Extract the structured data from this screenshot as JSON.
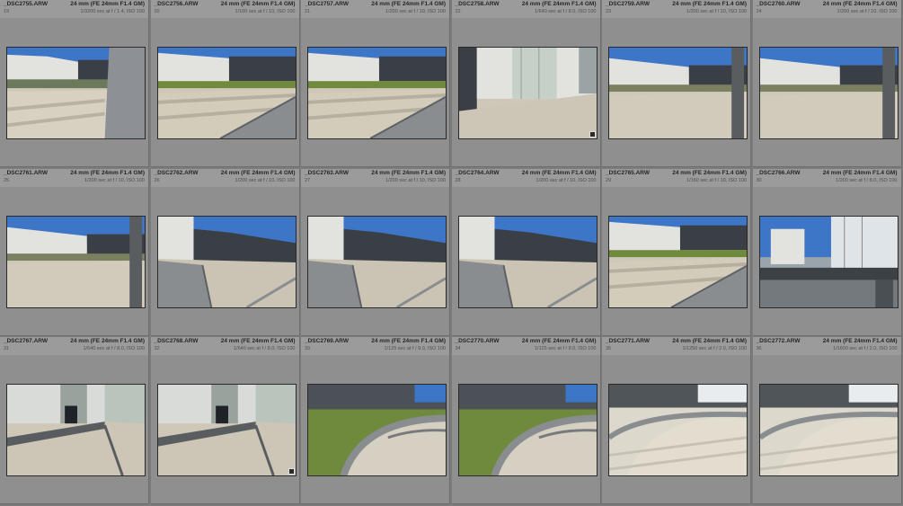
{
  "photos": [
    {
      "index": "19",
      "filename": "_DSC2755.ARW",
      "lens": "24 mm (FE 24mm F1.4 GM)",
      "exposure": "1/3200 sec at f / 1.4, ISO 100",
      "scene": "plaza-left",
      "badge": false
    },
    {
      "index": "20",
      "filename": "_DSC2756.ARW",
      "lens": "24 mm (FE 24mm F1.4 GM)",
      "exposure": "1/160 sec at f / 10, ISO 100",
      "scene": "plaza-rail",
      "badge": false
    },
    {
      "index": "21",
      "filename": "_DSC2757.ARW",
      "lens": "24 mm (FE 24mm F1.4 GM)",
      "exposure": "1/200 sec at f / 10, ISO 100",
      "scene": "plaza-rail",
      "badge": false
    },
    {
      "index": "22",
      "filename": "_DSC2758.ARW",
      "lens": "24 mm (FE 24mm F1.4 GM)",
      "exposure": "1/640 sec at f / 8.0, ISO 100",
      "scene": "building-wall",
      "badge": true
    },
    {
      "index": "23",
      "filename": "_DSC2759.ARW",
      "lens": "24 mm (FE 24mm F1.4 GM)",
      "exposure": "1/200 sec at f / 10, ISO 100",
      "scene": "plaza-wide",
      "badge": false
    },
    {
      "index": "24",
      "filename": "_DSC2760.ARW",
      "lens": "24 mm (FE 24mm F1.4 GM)",
      "exposure": "1/200 sec at f / 10, ISO 100",
      "scene": "plaza-wide",
      "badge": false
    },
    {
      "index": "25",
      "filename": "_DSC2761.ARW",
      "lens": "24 mm (FE 24mm F1.4 GM)",
      "exposure": "1/200 sec at f / 10, ISO 100",
      "scene": "plaza-wide",
      "badge": false
    },
    {
      "index": "26",
      "filename": "_DSC2762.ARW",
      "lens": "24 mm (FE 24mm F1.4 GM)",
      "exposure": "1/200 sec at f / 10, ISO 100",
      "scene": "ramp-rail",
      "badge": false
    },
    {
      "index": "27",
      "filename": "_DSC2763.ARW",
      "lens": "24 mm (FE 24mm F1.4 GM)",
      "exposure": "1/200 sec at f / 10, ISO 100",
      "scene": "ramp-rail",
      "badge": false
    },
    {
      "index": "28",
      "filename": "_DSC2764.ARW",
      "lens": "24 mm (FE 24mm F1.4 GM)",
      "exposure": "1/200 sec at f / 10, ISO 100",
      "scene": "ramp-rail",
      "badge": false
    },
    {
      "index": "29",
      "filename": "_DSC2765.ARW",
      "lens": "24 mm (FE 24mm F1.4 GM)",
      "exposure": "1/160 sec at f / 10, ISO 100",
      "scene": "plaza-rail",
      "badge": false
    },
    {
      "index": "30",
      "filename": "_DSC2766.ARW",
      "lens": "24 mm (FE 24mm F1.4 GM)",
      "exposure": "1/200 sec at f / 8.0, ISO 100",
      "scene": "towers-bridge",
      "badge": false
    },
    {
      "index": "31",
      "filename": "_DSC2767.ARW",
      "lens": "24 mm (FE 24mm F1.4 GM)",
      "exposure": "1/640 sec at f / 8.0, ISO 100",
      "scene": "building-front",
      "badge": false
    },
    {
      "index": "32",
      "filename": "_DSC2768.ARW",
      "lens": "24 mm (FE 24mm F1.4 GM)",
      "exposure": "1/640 sec at f / 8.0, ISO 100",
      "scene": "building-front",
      "badge": true
    },
    {
      "index": "33",
      "filename": "_DSC2769.ARW",
      "lens": "24 mm (FE 24mm F1.4 GM)",
      "exposure": "1/125 sec at f / 9.0, ISO 100",
      "scene": "curve-ramp",
      "badge": false
    },
    {
      "index": "34",
      "filename": "_DSC2770.ARW",
      "lens": "24 mm (FE 24mm F1.4 GM)",
      "exposure": "1/125 sec at f / 9.0, ISO 100",
      "scene": "curve-ramp",
      "badge": false
    },
    {
      "index": "35",
      "filename": "_DSC2771.ARW",
      "lens": "24 mm (FE 24mm F1.4 GM)",
      "exposure": "1/1250 sec at f / 2.0, ISO 100",
      "scene": "curve-ramp-bright",
      "badge": false
    },
    {
      "index": "36",
      "filename": "_DSC2772.ARW",
      "lens": "24 mm (FE 24mm F1.4 GM)",
      "exposure": "1/1600 sec at f / 2.0, ISO 100",
      "scene": "curve-ramp-bright",
      "badge": false
    }
  ],
  "colors": {
    "cell_background": "#8f8f8f",
    "header_background": "#9b9b9b",
    "grid_line": "#6e6e6e",
    "sky": "#3d76c6",
    "concrete": "#cfc8b8",
    "building": "#e2e2df",
    "rail": "#8a8d90",
    "glass": "#3a3f46",
    "grass": "#6f8a3c"
  }
}
